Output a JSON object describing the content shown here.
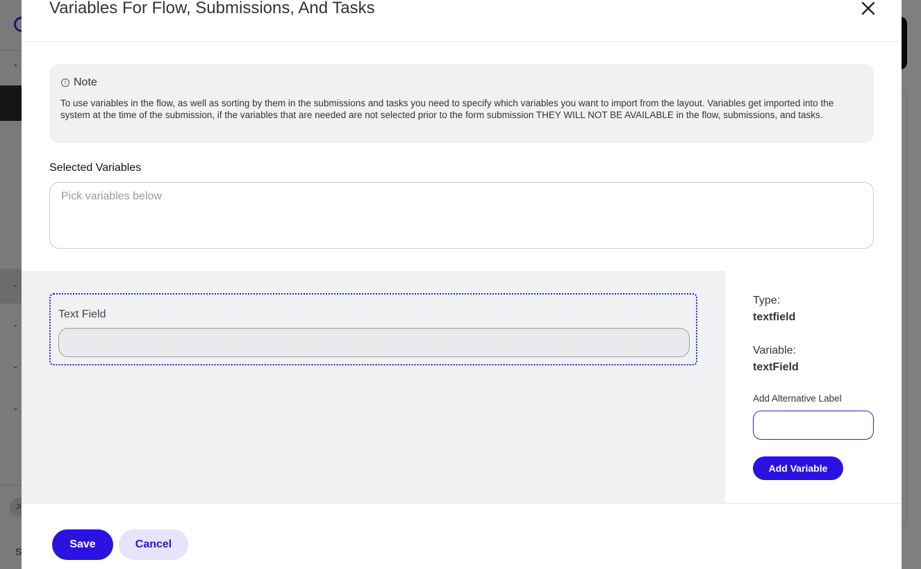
{
  "background": {
    "avatar_initials": "JI",
    "bottom_letter": "S"
  },
  "modal": {
    "title": "Variables For Flow, Submissions, And Tasks",
    "close_icon": "close-icon"
  },
  "note": {
    "heading": "Note",
    "icon": "info-icon",
    "text": "To use variables in the flow, as well as sorting by them in the submissions and tasks you need to specify which variables you want to import from the layout. Variables get imported into the system at the time of the submission, if the variables that are needed are not selected prior to the form submission THEY WILL NOT BE AVAILABLE in the flow, submissions, and tasks."
  },
  "selected_variables": {
    "label": "Selected Variables",
    "placeholder": "Pick variables below"
  },
  "layout_field": {
    "label": "Text Field",
    "value": ""
  },
  "details": {
    "type_label": "Type:",
    "type_value": "textfield",
    "variable_label": "Variable:",
    "variable_value": "textField",
    "alt_label_title": "Add Alternative Label",
    "alt_label_value": "",
    "add_button": "Add Variable"
  },
  "footer": {
    "save": "Save",
    "cancel": "Cancel"
  },
  "colors": {
    "accent": "#2b12e0",
    "accent_light": "#e6e4fb",
    "panel_bg": "#f0f1f3"
  }
}
